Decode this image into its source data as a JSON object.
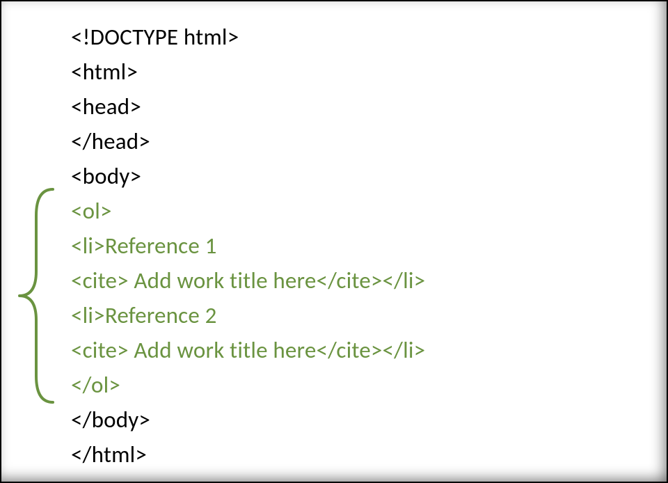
{
  "colors": {
    "text": "#000000",
    "highlight": "#6a9340",
    "border": "#000000"
  },
  "lines": {
    "l1": "<!DOCTYPE html>",
    "l2": "<html>",
    "l3": "<head>",
    "l4": "</head>",
    "l5": "<body>",
    "l6": "<ol>",
    "l7": "<li>Reference 1",
    "l8": "<cite> Add work title here</cite></li>",
    "l9": "<li>Reference 2",
    "l10": "<cite> Add work title here</cite></li>",
    "l11": "</ol>",
    "l12": "</body>",
    "l13": "</html>"
  }
}
